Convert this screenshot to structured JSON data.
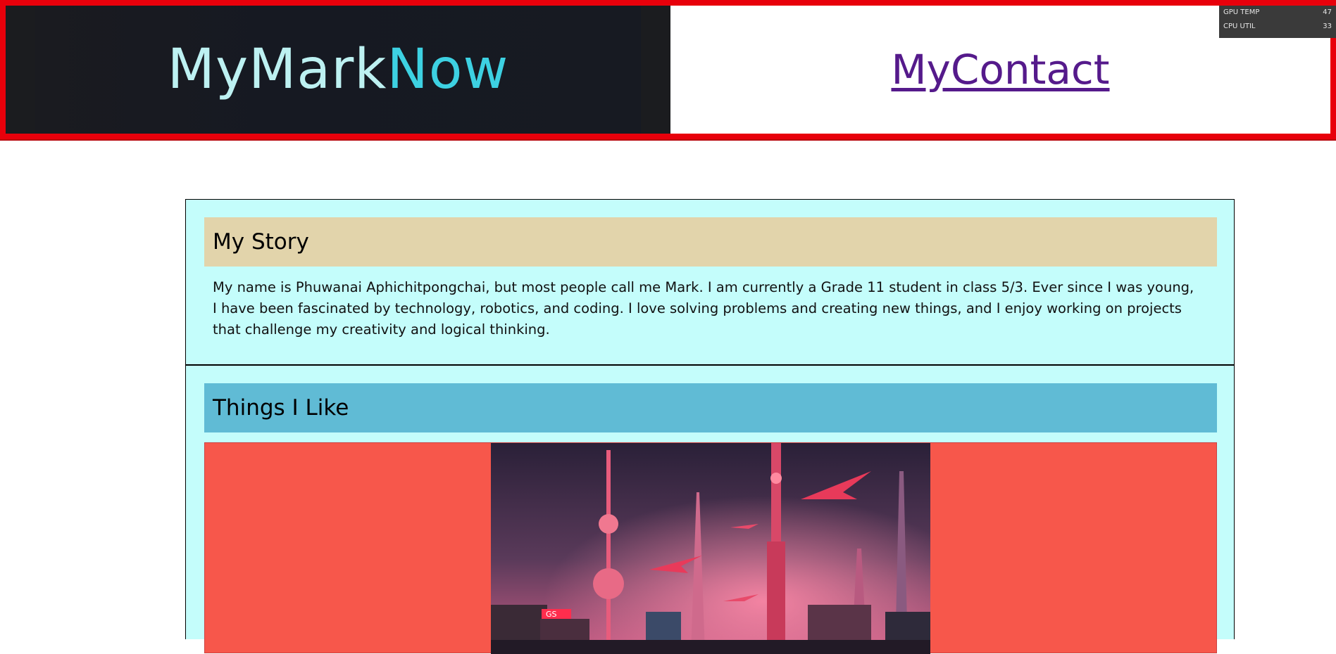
{
  "header": {
    "logo_part1": "MyMark",
    "logo_part2": "Now",
    "contact_label": "MyContact"
  },
  "hud": {
    "gpu_label": "GPU TEMP",
    "gpu_value": "47",
    "cpu_label": "CPU UTIL",
    "cpu_value": "33"
  },
  "story": {
    "heading": "My Story",
    "body": "My name is Phuwanai Aphichitpongchai, but most people call me Mark. I am currently a Grade 11 student in class 5/3. Ever since I was young, I have been fascinated by technology, robotics, and coding. I love solving problems and creating new things, and I enjoy working on projects that challenge my creativity and logical thinking."
  },
  "likes": {
    "heading": "Things I Like",
    "image_sign": "GS"
  },
  "colors": {
    "header_border": "#e8000b",
    "story_bg": "#c4fdfb",
    "story_head": "#e2d4ab",
    "like_head": "#60bbd5",
    "image_band": "#f7574b"
  }
}
